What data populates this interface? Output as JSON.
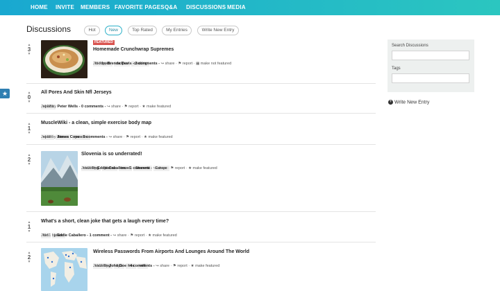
{
  "nav": [
    "HOME",
    "INVITE",
    "MEMBERS",
    "FAVORITE PAGES",
    "Q&A",
    "DISCUSSIONS",
    "MEDIA"
  ],
  "page_title": "Discussions",
  "filters": [
    "Hot",
    "New",
    "Top Rated",
    "My Entries",
    "Write New Entry"
  ],
  "active_filter": "New",
  "entries": [
    {
      "votes": "3",
      "badge": "FEATURED",
      "title": "Homemade Crunchwrap Supremes",
      "tags": [
        "foodporn",
        "recipes",
        "cooking"
      ],
      "date": "Jul 7 by ",
      "author": "Brenda Davis",
      "comments": "- 2 comments -",
      "share": "share",
      "report": "report",
      "feature": "make not featured"
    },
    {
      "votes": "0",
      "title": "All Pores And Skin Nfl Jerseys",
      "tags": [
        "sports"
      ],
      "date": "Jul 13 by ",
      "author": "Peter Wells",
      "comments": "- 0 comments -",
      "share": "share",
      "report": "report",
      "feature": "make featured"
    },
    {
      "votes": "1",
      "title": "MuscleWiki - a clean, simple exercise body map",
      "tags": [
        "sport",
        "fitness",
        "muscles"
      ],
      "date": "Jul 11 by ",
      "author": "James Cope",
      "comments": "- 0 comments -",
      "share": "share",
      "report": "report",
      "feature": "make featured"
    },
    {
      "votes": "2",
      "title": "Slovenia is so underrated!",
      "tags": [
        "travelling",
        "places",
        "travel",
        "Slovenia",
        "Europe"
      ],
      "date": "Jul 11 by ",
      "author": "Eddie Caballero",
      "comments": "- 1 comment -",
      "share": "share",
      "report": "report",
      "feature": "make featured"
    },
    {
      "votes": "1",
      "title": "What's a short, clean joke that gets a laugh every time?",
      "tags": [
        "fun",
        "jokes"
      ],
      "date": "Jul 11 by ",
      "author": "Eddie Caballero",
      "comments": "- 1 comment -",
      "share": "share",
      "report": "report",
      "feature": "make featured"
    },
    {
      "votes": "2",
      "title": "Wireless Passwords From Airports And Lounges Around The World",
      "tags": [
        "travelling",
        "tips",
        "free",
        "wifi"
      ],
      "date": "Jul 11 by ",
      "author": "John Doe",
      "comments": "- 4 comments -",
      "share": "share",
      "report": "report",
      "feature": "make featured"
    }
  ],
  "sidebar": {
    "search_label": "Search Discussions",
    "tags_label": "Tags",
    "write_new": "Write New Entry"
  },
  "icons": {
    "share": "share-icon",
    "report": "flag-icon",
    "feature": "star-icon",
    "unfeature": "calendar-icon"
  }
}
